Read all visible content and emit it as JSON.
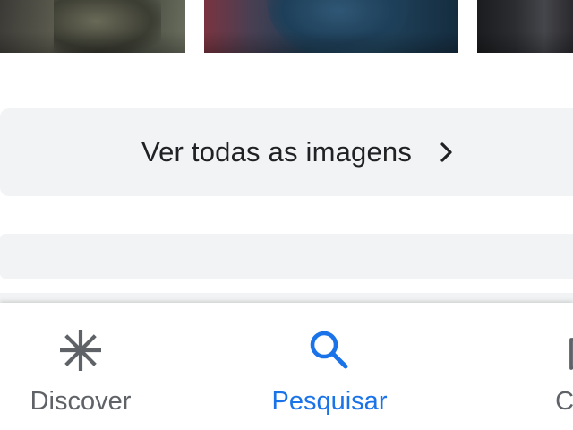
{
  "see_all": {
    "label": "Ver todas as imagens",
    "icon": "chevron-right-icon"
  },
  "bottom_nav": {
    "items": [
      {
        "label": "Discover",
        "icon": "asterisk-icon",
        "active": false
      },
      {
        "label": "Pesquisar",
        "icon": "search-icon",
        "active": true
      },
      {
        "label": "Cole",
        "icon": "bookmarks-icon",
        "active": false
      }
    ]
  },
  "colors": {
    "active": "#1a73e8",
    "inactive": "#5f6368",
    "card_background": "#f1f3f4",
    "text": "#202124"
  }
}
